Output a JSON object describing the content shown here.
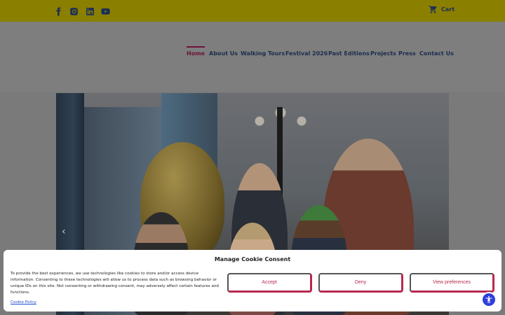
{
  "topbar": {
    "social_icons": [
      "facebook-icon",
      "instagram-icon",
      "linkedin-icon",
      "youtube-icon"
    ],
    "cart_label": "Cart"
  },
  "nav": {
    "items": [
      {
        "label": "Home",
        "active": true
      },
      {
        "label": "About Us"
      },
      {
        "label": "Walking Tours"
      },
      {
        "label": "Festival 2026"
      },
      {
        "label": "Past Editions"
      },
      {
        "label": "Projects"
      },
      {
        "label": "Press"
      },
      {
        "label": "Contact Us"
      }
    ]
  },
  "hero": {
    "prev_arrow": "‹"
  },
  "cookie": {
    "title": "Manage Cookie Consent",
    "text": "To provide the best experiences, we use technologies like cookies to store and/or access device information. Consenting to these technologies will allow us to process data such as browsing behavior or unique IDs on this site. Not consenting or withdrawing consent, may adversely affect certain features and functions.",
    "accept_label": "Accept",
    "deny_label": "Deny",
    "preferences_label": "View preferences",
    "policy_link": "Cookie Policy"
  },
  "colors": {
    "topbar": "#8b7f00",
    "nav_text": "#1c2d4f",
    "nav_active": "#6b1437",
    "button_accent": "#b8284f",
    "accessibility": "#2e3fd8"
  }
}
